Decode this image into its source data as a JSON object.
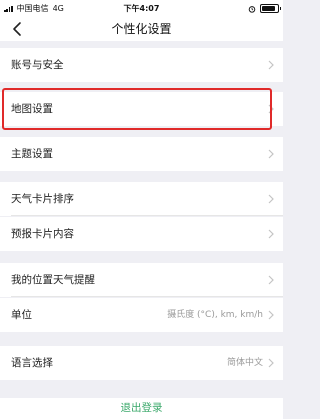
{
  "status_bar": {
    "carrier": "中国电信",
    "network": "4G",
    "time": "下午4:07"
  },
  "nav": {
    "title": "个性化设置",
    "back_icon": "chevron-left-icon"
  },
  "rows": [
    {
      "label": "账号与安全",
      "value": ""
    },
    {
      "label": "地图设置",
      "value": ""
    },
    {
      "label": "主题设置",
      "value": ""
    },
    {
      "label": "天气卡片排序",
      "value": ""
    },
    {
      "label": "预报卡片内容",
      "value": ""
    },
    {
      "label": "我的位置天气提醒",
      "value": ""
    },
    {
      "label": "单位",
      "value": "摄氏度 (°C), km, km/h"
    },
    {
      "label": "语言选择",
      "value": "简体中文"
    }
  ],
  "logout_label": "退出登录",
  "colors": {
    "highlight": "#e02a2a",
    "logout": "#3aa86a",
    "background": "#efeff4"
  }
}
